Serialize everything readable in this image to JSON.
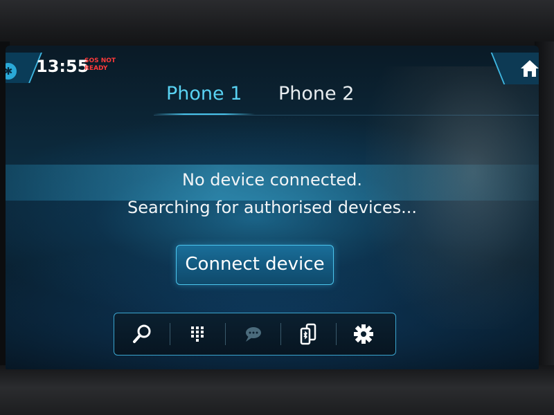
{
  "status_bar": {
    "bluetooth_icon": "bluetooth-icon",
    "time": "13:55",
    "sos_line1": "SOS NOT",
    "sos_line2": "READY",
    "sos_color": "#ff3a3a",
    "home_icon": "home-icon"
  },
  "tabs": [
    {
      "label": "Phone 1",
      "active": true
    },
    {
      "label": "Phone 2",
      "active": false
    }
  ],
  "main": {
    "status_message": "No device connected.",
    "search_message": "Searching for authorised devices...",
    "connect_button_label": "Connect device"
  },
  "toolbar": {
    "items": [
      {
        "icon": "search-icon"
      },
      {
        "icon": "keypad-icon"
      },
      {
        "icon": "messages-icon",
        "disabled": true
      },
      {
        "icon": "phone-devices-icon"
      },
      {
        "icon": "settings-icon"
      }
    ]
  },
  "colors": {
    "accent": "#49c3ea",
    "active_tab": "#59d2f2",
    "text": "#f2f5f7"
  }
}
